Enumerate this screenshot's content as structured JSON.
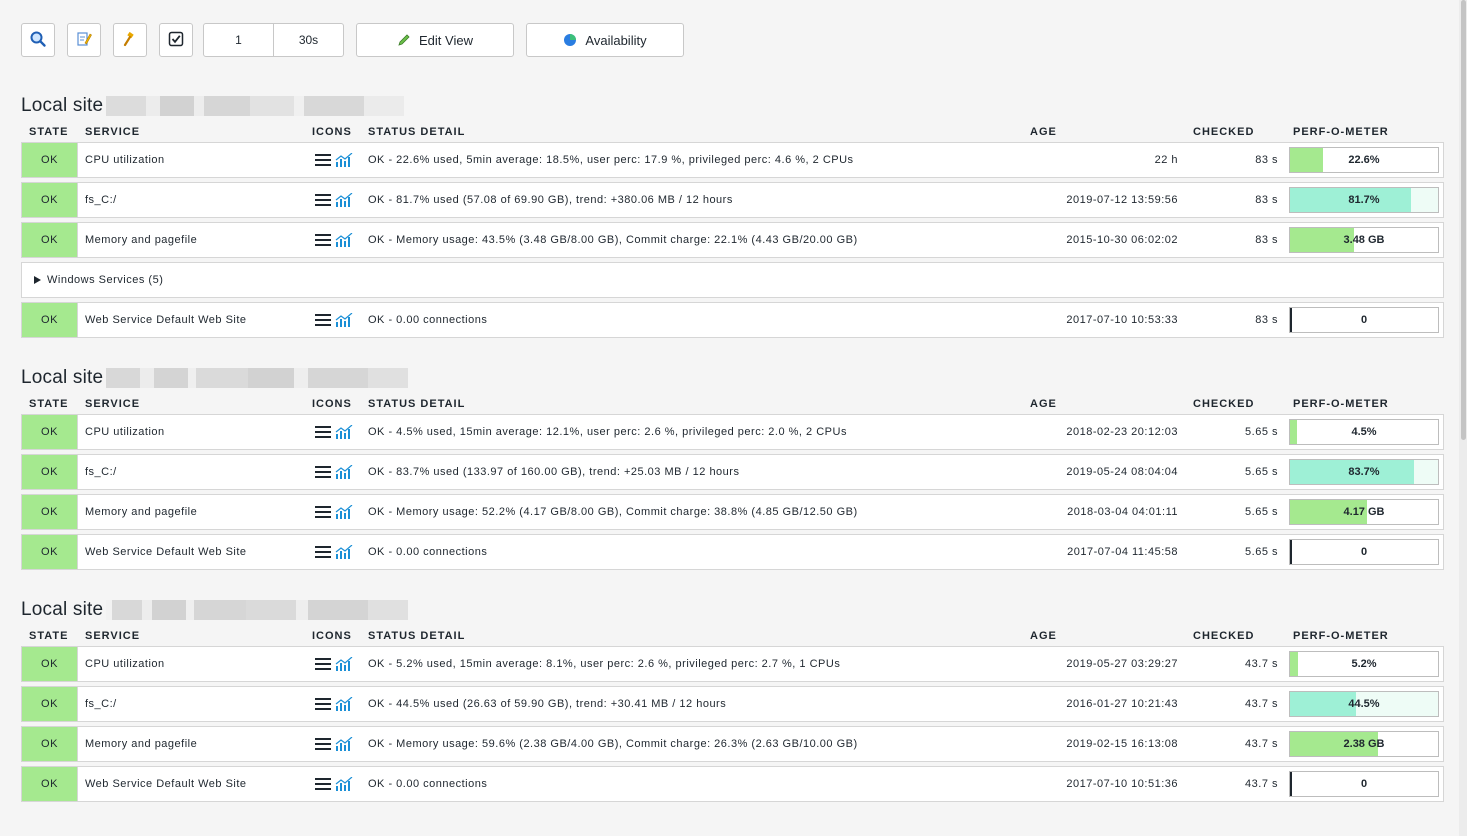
{
  "toolbar": {
    "refresh_count": "1",
    "refresh_interval": "30s",
    "edit_view_label": "Edit View",
    "availability_label": "Availability"
  },
  "columns": {
    "state": "STATE",
    "service": "SERVICE",
    "icons": "ICONS",
    "status_detail": "STATUS DETAIL",
    "age": "AGE",
    "checked": "CHECKED",
    "perf": "PERF-O-METER"
  },
  "groups": [
    {
      "title": "Local site",
      "rows": [
        {
          "state": "OK",
          "service": "CPU utilization",
          "detail": "OK - 22.6% used, 5min average: 18.5%, user perc: 17.9 %, privileged perc: 4.6 %, 2 CPUs",
          "age": "22 h",
          "checked": "83 s",
          "perf": "22.6%",
          "perf_fraction": 0.226,
          "perf_color": "#a5e98f"
        },
        {
          "state": "OK",
          "service": "fs_C:/",
          "detail": "OK - 81.7% used (57.08 of 69.90 GB), trend: +380.06 MB / 12 hours",
          "age": "2019-07-12 13:59:56",
          "checked": "83 s",
          "perf": "81.7%",
          "perf_fraction": 0.817,
          "perf_color": "#9ef0d6",
          "perf_rest_color": "#eefcf6"
        },
        {
          "state": "OK",
          "service": "Memory and pagefile",
          "detail": "OK - Memory usage: 43.5% (3.48 GB/8.00 GB), Commit charge: 22.1% (4.43 GB/20.00 GB)",
          "age": "2015-10-30 06:02:02",
          "checked": "83 s",
          "perf": "3.48 GB",
          "perf_fraction": 0.435,
          "perf_color": "#a5e98f"
        },
        {
          "toggle": true,
          "label": "Windows Services (5)"
        },
        {
          "state": "OK",
          "service": "Web Service Default Web Site",
          "detail": "OK - 0.00 connections",
          "age": "2017-07-10 10:53:33",
          "checked": "83 s",
          "perf": "0",
          "perf_fraction": 0.0,
          "perf_color": "#a5e98f"
        }
      ]
    },
    {
      "title": "Local site",
      "rows": [
        {
          "state": "OK",
          "service": "CPU utilization",
          "detail": "OK - 4.5% used, 15min average: 12.1%, user perc: 2.6 %, privileged perc: 2.0 %, 2 CPUs",
          "age": "2018-02-23 20:12:03",
          "checked": "5.65 s",
          "perf": "4.5%",
          "perf_fraction": 0.045,
          "perf_color": "#a5e98f"
        },
        {
          "state": "OK",
          "service": "fs_C:/",
          "detail": "OK - 83.7% used (133.97 of 160.00 GB), trend: +25.03 MB / 12 hours",
          "age": "2019-05-24 08:04:04",
          "checked": "5.65 s",
          "perf": "83.7%",
          "perf_fraction": 0.837,
          "perf_color": "#9ef0d6",
          "perf_rest_color": "#eefcf6"
        },
        {
          "state": "OK",
          "service": "Memory and pagefile",
          "detail": "OK - Memory usage: 52.2% (4.17 GB/8.00 GB), Commit charge: 38.8% (4.85 GB/12.50 GB)",
          "age": "2018-03-04 04:01:11",
          "checked": "5.65 s",
          "perf": "4.17 GB",
          "perf_fraction": 0.522,
          "perf_color": "#a5e98f"
        },
        {
          "state": "OK",
          "service": "Web Service Default Web Site",
          "detail": "OK - 0.00 connections",
          "age": "2017-07-04 11:45:58",
          "checked": "5.65 s",
          "perf": "0",
          "perf_fraction": 0.0,
          "perf_color": "#a5e98f"
        }
      ]
    },
    {
      "title": "Local site",
      "rows": [
        {
          "state": "OK",
          "service": "CPU utilization",
          "detail": "OK - 5.2% used, 15min average: 8.1%, user perc: 2.6 %, privileged perc: 2.7 %, 1 CPUs",
          "age": "2019-05-27 03:29:27",
          "checked": "43.7 s",
          "perf": "5.2%",
          "perf_fraction": 0.052,
          "perf_color": "#a5e98f"
        },
        {
          "state": "OK",
          "service": "fs_C:/",
          "detail": "OK - 44.5% used (26.63 of 59.90 GB), trend: +30.41 MB / 12 hours",
          "age": "2016-01-27 10:21:43",
          "checked": "43.7 s",
          "perf": "44.5%",
          "perf_fraction": 0.445,
          "perf_color": "#9ef0d6",
          "perf_rest_color": "#eefcf6"
        },
        {
          "state": "OK",
          "service": "Memory and pagefile",
          "detail": "OK - Memory usage: 59.6% (2.38 GB/4.00 GB), Commit charge: 26.3% (2.63 GB/10.00 GB)",
          "age": "2019-02-15 16:13:08",
          "checked": "43.7 s",
          "perf": "2.38 GB",
          "perf_fraction": 0.596,
          "perf_color": "#a5e98f"
        },
        {
          "state": "OK",
          "service": "Web Service Default Web Site",
          "detail": "OK - 0.00 connections",
          "age": "2017-07-10 10:51:36",
          "checked": "43.7 s",
          "perf": "0",
          "perf_fraction": 0.0,
          "perf_color": "#a5e98f"
        }
      ]
    }
  ]
}
